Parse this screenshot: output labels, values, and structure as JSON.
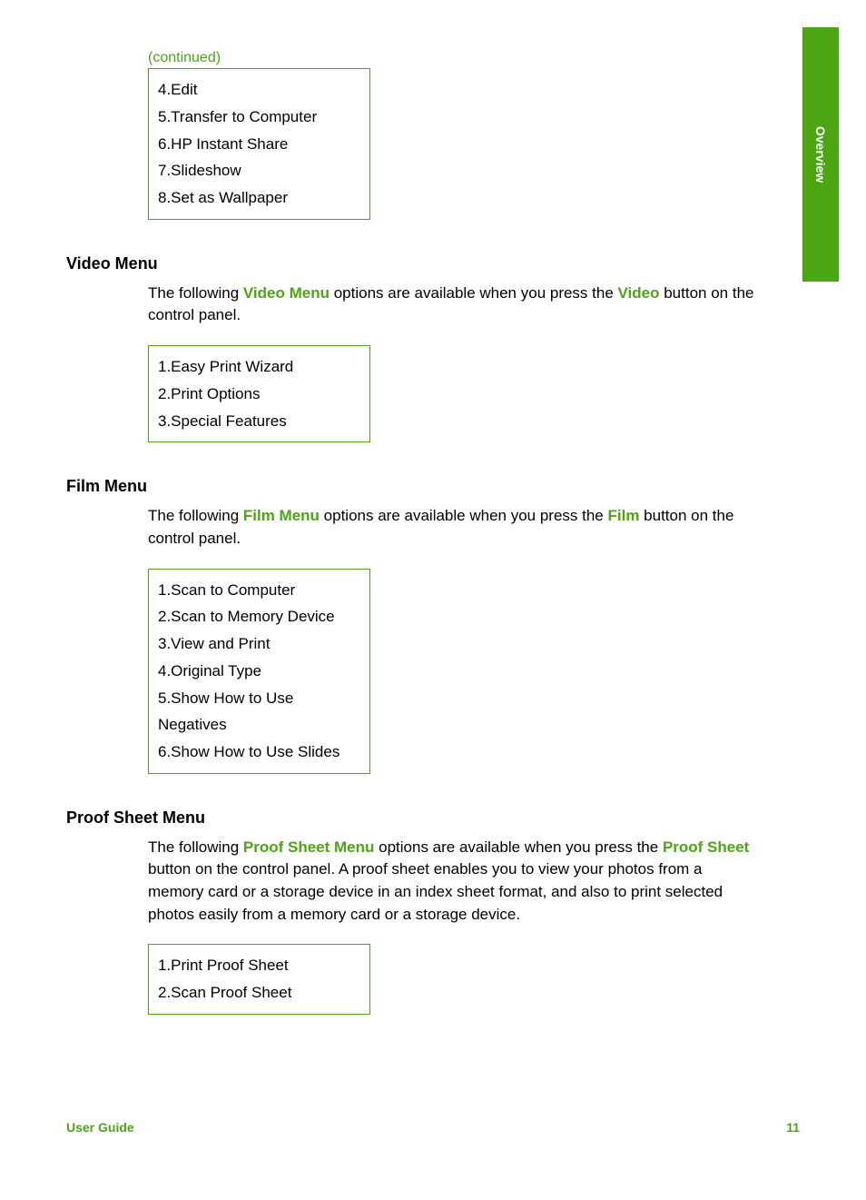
{
  "sideTab": {
    "label": "Overview"
  },
  "continuedLabel": "(continued)",
  "box1": {
    "items": [
      "4.Edit",
      "5.Transfer to Computer",
      "6.HP Instant Share",
      "7.Slideshow",
      "8.Set as Wallpaper"
    ]
  },
  "section2": {
    "heading": "Video Menu",
    "para_pre": "The following ",
    "hl1": "Video Menu",
    "para_mid": " options are available when you press the ",
    "hl2": "Video",
    "para_post": " button on the control panel.",
    "items": [
      "1.Easy Print Wizard",
      "2.Print Options",
      "3.Special Features"
    ]
  },
  "section3": {
    "heading": "Film Menu",
    "para_pre": "The following ",
    "hl1": "Film Menu",
    "para_mid": " options are available when you press the ",
    "hl2": "Film",
    "para_post": " button on the control panel.",
    "items": [
      "1.Scan to Computer",
      "2.Scan to Memory Device",
      "3.View and Print",
      "4.Original Type",
      "5.Show How to Use Negatives",
      "6.Show How to Use Slides"
    ]
  },
  "section4": {
    "heading": "Proof Sheet Menu",
    "para_pre": "The following ",
    "hl1": "Proof Sheet Menu",
    "para_mid": " options are available when you press the ",
    "hl2": "Proof Sheet",
    "para_post": " button on the control panel. A proof sheet enables you to view your photos from a memory card or a storage device in an index sheet format, and also to print selected photos easily from a memory card or a storage device.",
    "items": [
      "1.Print Proof Sheet",
      "2.Scan Proof Sheet"
    ]
  },
  "footer": {
    "left": "User Guide",
    "right": "11"
  }
}
